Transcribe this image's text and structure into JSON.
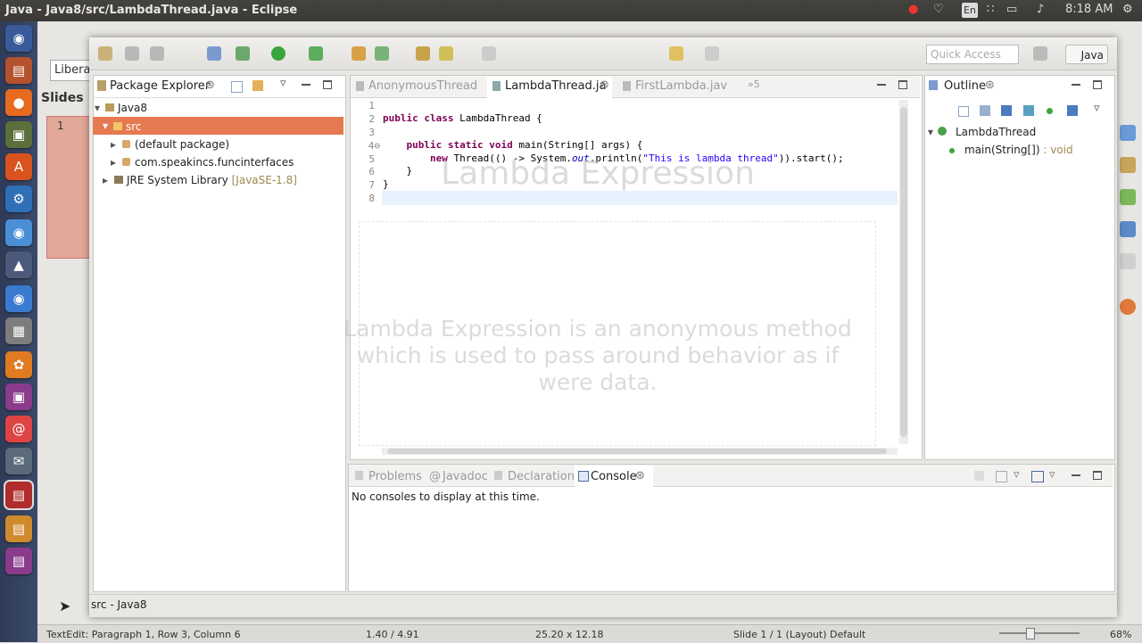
{
  "topbar": {
    "window_title": "Java - Java8/src/LambdaThread.java - Eclipse",
    "keyboard": "En",
    "time": "8:18 AM"
  },
  "impress": {
    "font_box": "Libera",
    "slides_label": "Slides",
    "slide_number": "1",
    "slide_title": "Lambda Expression",
    "slide_body": "Lambda Expression is an anonymous method which is used to pass around behavior as if were data.",
    "status": {
      "text_edit": "TextEdit: Paragraph 1, Row 3, Column 6",
      "position": "1.40 / 4.91",
      "size": "25.20 x 12.18",
      "slide": "Slide 1 / 1 (Layout)",
      "master": "Default",
      "zoom": "68%"
    }
  },
  "eclipse": {
    "quick_access_placeholder": "Quick Access",
    "perspective": "Java",
    "package_explorer": {
      "title": "Package Explorer",
      "tree": [
        {
          "label": "Java8",
          "level": 0,
          "icon": "project-icon"
        },
        {
          "label": "src",
          "level": 1,
          "icon": "source-folder-icon",
          "selected": true
        },
        {
          "label": "(default package)",
          "level": 2,
          "icon": "package-icon"
        },
        {
          "label": "com.speakincs.funcinterfaces",
          "level": 2,
          "icon": "package-icon"
        },
        {
          "label": "JRE System Library",
          "suffix": "[JavaSE-1.8]",
          "level": 1,
          "icon": "library-icon"
        }
      ]
    },
    "editor_tabs": [
      "AnonymousThread",
      "LambdaThread.ja",
      "FirstLambda.jav",
      "»5"
    ],
    "active_tab": "LambdaThread.ja",
    "code_lines": {
      "l1": "",
      "l2_kw": "public class ",
      "l2_rest": "LambdaThread {",
      "l3": "",
      "l4_kw": "    public static void ",
      "l4_rest": "main(String[] args) {",
      "l5_kw": "        new ",
      "l5_a": "Thread(() -> System.",
      "l5_out": "out",
      "l5_b": ".println(",
      "l5_str": "\"This is lambda thread\"",
      "l5_c": ")).start();",
      "l6": "    }",
      "l7": "}",
      "l8": ""
    },
    "line_numbers": [
      "1",
      "2",
      "3",
      "4⊖",
      "5",
      "6",
      "7",
      "8"
    ],
    "outline": {
      "title": "Outline",
      "class_name": "LambdaThread",
      "method": "main(String[])",
      "method_type": " : void"
    },
    "bottom_tabs": [
      "Problems",
      "Javadoc",
      "Declaration",
      "Console"
    ],
    "console_message": "No consoles to display at this time.",
    "status": "src - Java8"
  },
  "colors": {
    "selection": "#e5794f",
    "keyword": "#7f0055",
    "string": "#2a00ff"
  }
}
